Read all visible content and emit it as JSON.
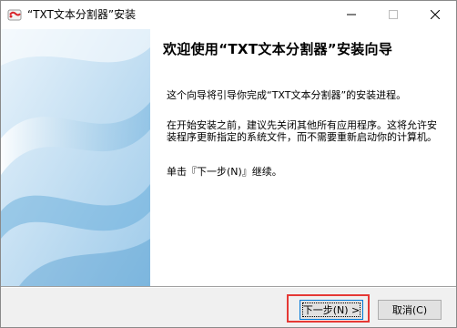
{
  "window": {
    "title": "“TXT文本分割器”安装",
    "title_icon": "installer-app-icon",
    "controls": {
      "minimize": "minimize-icon",
      "maximize": "maximize-icon",
      "close": "close-icon"
    }
  },
  "wizard": {
    "heading": "欢迎使用“TXT文本分割器”安装向导",
    "paragraph1": "这个向导将引导你完成“TXT文本分割器”的安装进程。",
    "paragraph2": "在开始安装之前，建议先关闭其他所有应用程序。这将允许安装程序更新指定的系统文件，而不需要重新启动你的计算机。",
    "paragraph3": "单击『下一步(N)』继续。"
  },
  "buttons": {
    "next": "下一步(N) >",
    "cancel": "取消(C)"
  },
  "colors": {
    "accent_blue": "#0078d7",
    "highlight_red": "#e53935",
    "art_blue": "#5aa6d8"
  }
}
